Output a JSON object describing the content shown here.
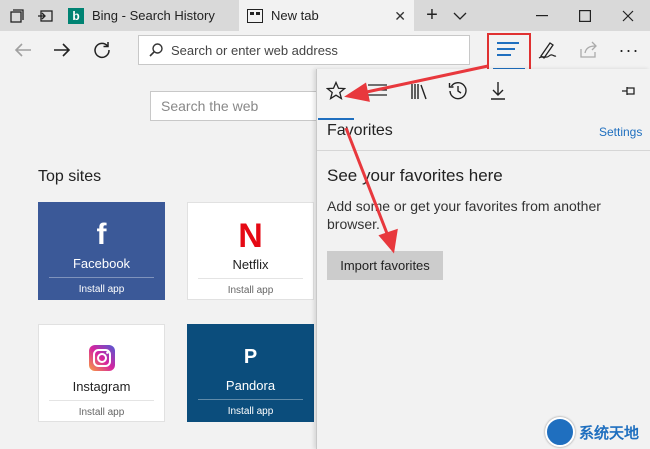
{
  "tabs": [
    {
      "label": "Bing - Search History",
      "favicon": "b"
    },
    {
      "label": "New tab"
    }
  ],
  "address_bar": {
    "placeholder": "Search or enter web address"
  },
  "new_tab_page": {
    "search_placeholder": "Search the web",
    "top_sites_title": "Top sites",
    "tiles": [
      {
        "name": "Facebook",
        "install": "Install app",
        "logo": "f",
        "color": "#3b5998"
      },
      {
        "name": "Netflix",
        "install": "Install app",
        "logo": "N",
        "color": "#e50914"
      },
      {
        "name": "Instagram",
        "install": "Install app",
        "color": "#c13584"
      },
      {
        "name": "Pandora",
        "install": "Install app",
        "logo": "P",
        "color": "#0b4d7c"
      }
    ]
  },
  "hub": {
    "title": "Favorites",
    "settings_label": "Settings",
    "heading": "See your favorites here",
    "description": "Add some or get your favorites from another browser.",
    "import_button": "Import favorites"
  },
  "watermark": {
    "text": "系统天地"
  },
  "colors": {
    "accent": "#1f6fbf",
    "highlight": "#e03131"
  }
}
